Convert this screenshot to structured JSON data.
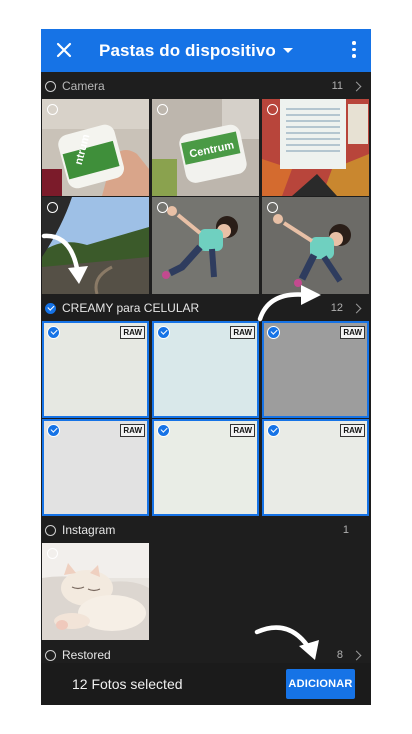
{
  "app_bar": {
    "title": "Pastas do dispositivo",
    "icons": {
      "close": "close-icon",
      "dropdown": "caret-down-icon",
      "menu": "more-vert-icon"
    }
  },
  "sections": {
    "camera": {
      "name": "Camera",
      "count": "11"
    },
    "creamy": {
      "name": "CREAMY para CELULAR",
      "count": "12"
    },
    "instagram": {
      "name": "Instagram",
      "count": "1"
    },
    "restored": {
      "name": "Restored",
      "count": "8"
    }
  },
  "raw_badge": "RAW",
  "footer": {
    "selected_text": "12 Fotos selected",
    "add_button": "ADICIONAR"
  },
  "colors": {
    "accent": "#1673e6",
    "background": "#1e1e1e",
    "bar": "#1b1b1b"
  }
}
